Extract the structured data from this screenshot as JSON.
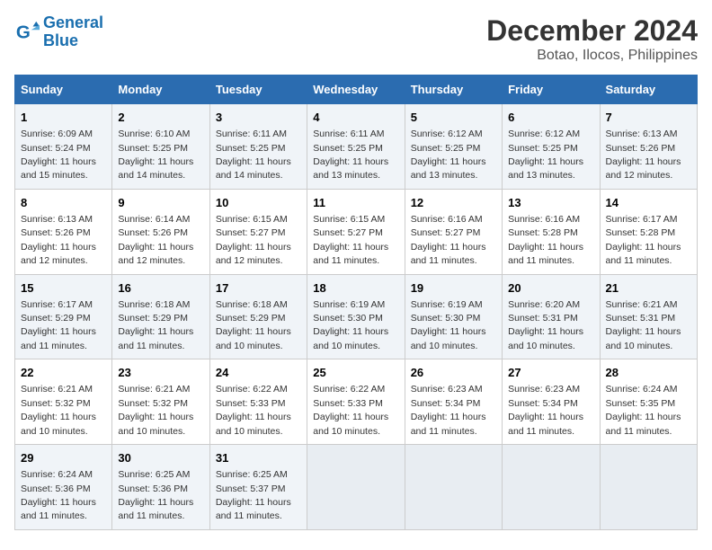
{
  "logo": {
    "line1": "General",
    "line2": "Blue"
  },
  "title": "December 2024",
  "subtitle": "Botao, Ilocos, Philippines",
  "days_of_week": [
    "Sunday",
    "Monday",
    "Tuesday",
    "Wednesday",
    "Thursday",
    "Friday",
    "Saturday"
  ],
  "weeks": [
    [
      {
        "day": "1",
        "sunrise": "6:09 AM",
        "sunset": "5:24 PM",
        "daylight": "11 hours and 15 minutes."
      },
      {
        "day": "2",
        "sunrise": "6:10 AM",
        "sunset": "5:25 PM",
        "daylight": "11 hours and 14 minutes."
      },
      {
        "day": "3",
        "sunrise": "6:11 AM",
        "sunset": "5:25 PM",
        "daylight": "11 hours and 14 minutes."
      },
      {
        "day": "4",
        "sunrise": "6:11 AM",
        "sunset": "5:25 PM",
        "daylight": "11 hours and 13 minutes."
      },
      {
        "day": "5",
        "sunrise": "6:12 AM",
        "sunset": "5:25 PM",
        "daylight": "11 hours and 13 minutes."
      },
      {
        "day": "6",
        "sunrise": "6:12 AM",
        "sunset": "5:25 PM",
        "daylight": "11 hours and 13 minutes."
      },
      {
        "day": "7",
        "sunrise": "6:13 AM",
        "sunset": "5:26 PM",
        "daylight": "11 hours and 12 minutes."
      }
    ],
    [
      {
        "day": "8",
        "sunrise": "6:13 AM",
        "sunset": "5:26 PM",
        "daylight": "11 hours and 12 minutes."
      },
      {
        "day": "9",
        "sunrise": "6:14 AM",
        "sunset": "5:26 PM",
        "daylight": "11 hours and 12 minutes."
      },
      {
        "day": "10",
        "sunrise": "6:15 AM",
        "sunset": "5:27 PM",
        "daylight": "11 hours and 12 minutes."
      },
      {
        "day": "11",
        "sunrise": "6:15 AM",
        "sunset": "5:27 PM",
        "daylight": "11 hours and 11 minutes."
      },
      {
        "day": "12",
        "sunrise": "6:16 AM",
        "sunset": "5:27 PM",
        "daylight": "11 hours and 11 minutes."
      },
      {
        "day": "13",
        "sunrise": "6:16 AM",
        "sunset": "5:28 PM",
        "daylight": "11 hours and 11 minutes."
      },
      {
        "day": "14",
        "sunrise": "6:17 AM",
        "sunset": "5:28 PM",
        "daylight": "11 hours and 11 minutes."
      }
    ],
    [
      {
        "day": "15",
        "sunrise": "6:17 AM",
        "sunset": "5:29 PM",
        "daylight": "11 hours and 11 minutes."
      },
      {
        "day": "16",
        "sunrise": "6:18 AM",
        "sunset": "5:29 PM",
        "daylight": "11 hours and 11 minutes."
      },
      {
        "day": "17",
        "sunrise": "6:18 AM",
        "sunset": "5:29 PM",
        "daylight": "11 hours and 10 minutes."
      },
      {
        "day": "18",
        "sunrise": "6:19 AM",
        "sunset": "5:30 PM",
        "daylight": "11 hours and 10 minutes."
      },
      {
        "day": "19",
        "sunrise": "6:19 AM",
        "sunset": "5:30 PM",
        "daylight": "11 hours and 10 minutes."
      },
      {
        "day": "20",
        "sunrise": "6:20 AM",
        "sunset": "5:31 PM",
        "daylight": "11 hours and 10 minutes."
      },
      {
        "day": "21",
        "sunrise": "6:21 AM",
        "sunset": "5:31 PM",
        "daylight": "11 hours and 10 minutes."
      }
    ],
    [
      {
        "day": "22",
        "sunrise": "6:21 AM",
        "sunset": "5:32 PM",
        "daylight": "11 hours and 10 minutes."
      },
      {
        "day": "23",
        "sunrise": "6:21 AM",
        "sunset": "5:32 PM",
        "daylight": "11 hours and 10 minutes."
      },
      {
        "day": "24",
        "sunrise": "6:22 AM",
        "sunset": "5:33 PM",
        "daylight": "11 hours and 10 minutes."
      },
      {
        "day": "25",
        "sunrise": "6:22 AM",
        "sunset": "5:33 PM",
        "daylight": "11 hours and 10 minutes."
      },
      {
        "day": "26",
        "sunrise": "6:23 AM",
        "sunset": "5:34 PM",
        "daylight": "11 hours and 11 minutes."
      },
      {
        "day": "27",
        "sunrise": "6:23 AM",
        "sunset": "5:34 PM",
        "daylight": "11 hours and 11 minutes."
      },
      {
        "day": "28",
        "sunrise": "6:24 AM",
        "sunset": "5:35 PM",
        "daylight": "11 hours and 11 minutes."
      }
    ],
    [
      {
        "day": "29",
        "sunrise": "6:24 AM",
        "sunset": "5:36 PM",
        "daylight": "11 hours and 11 minutes."
      },
      {
        "day": "30",
        "sunrise": "6:25 AM",
        "sunset": "5:36 PM",
        "daylight": "11 hours and 11 minutes."
      },
      {
        "day": "31",
        "sunrise": "6:25 AM",
        "sunset": "5:37 PM",
        "daylight": "11 hours and 11 minutes."
      },
      null,
      null,
      null,
      null
    ]
  ],
  "labels": {
    "sunrise": "Sunrise:",
    "sunset": "Sunset:",
    "daylight": "Daylight:"
  }
}
